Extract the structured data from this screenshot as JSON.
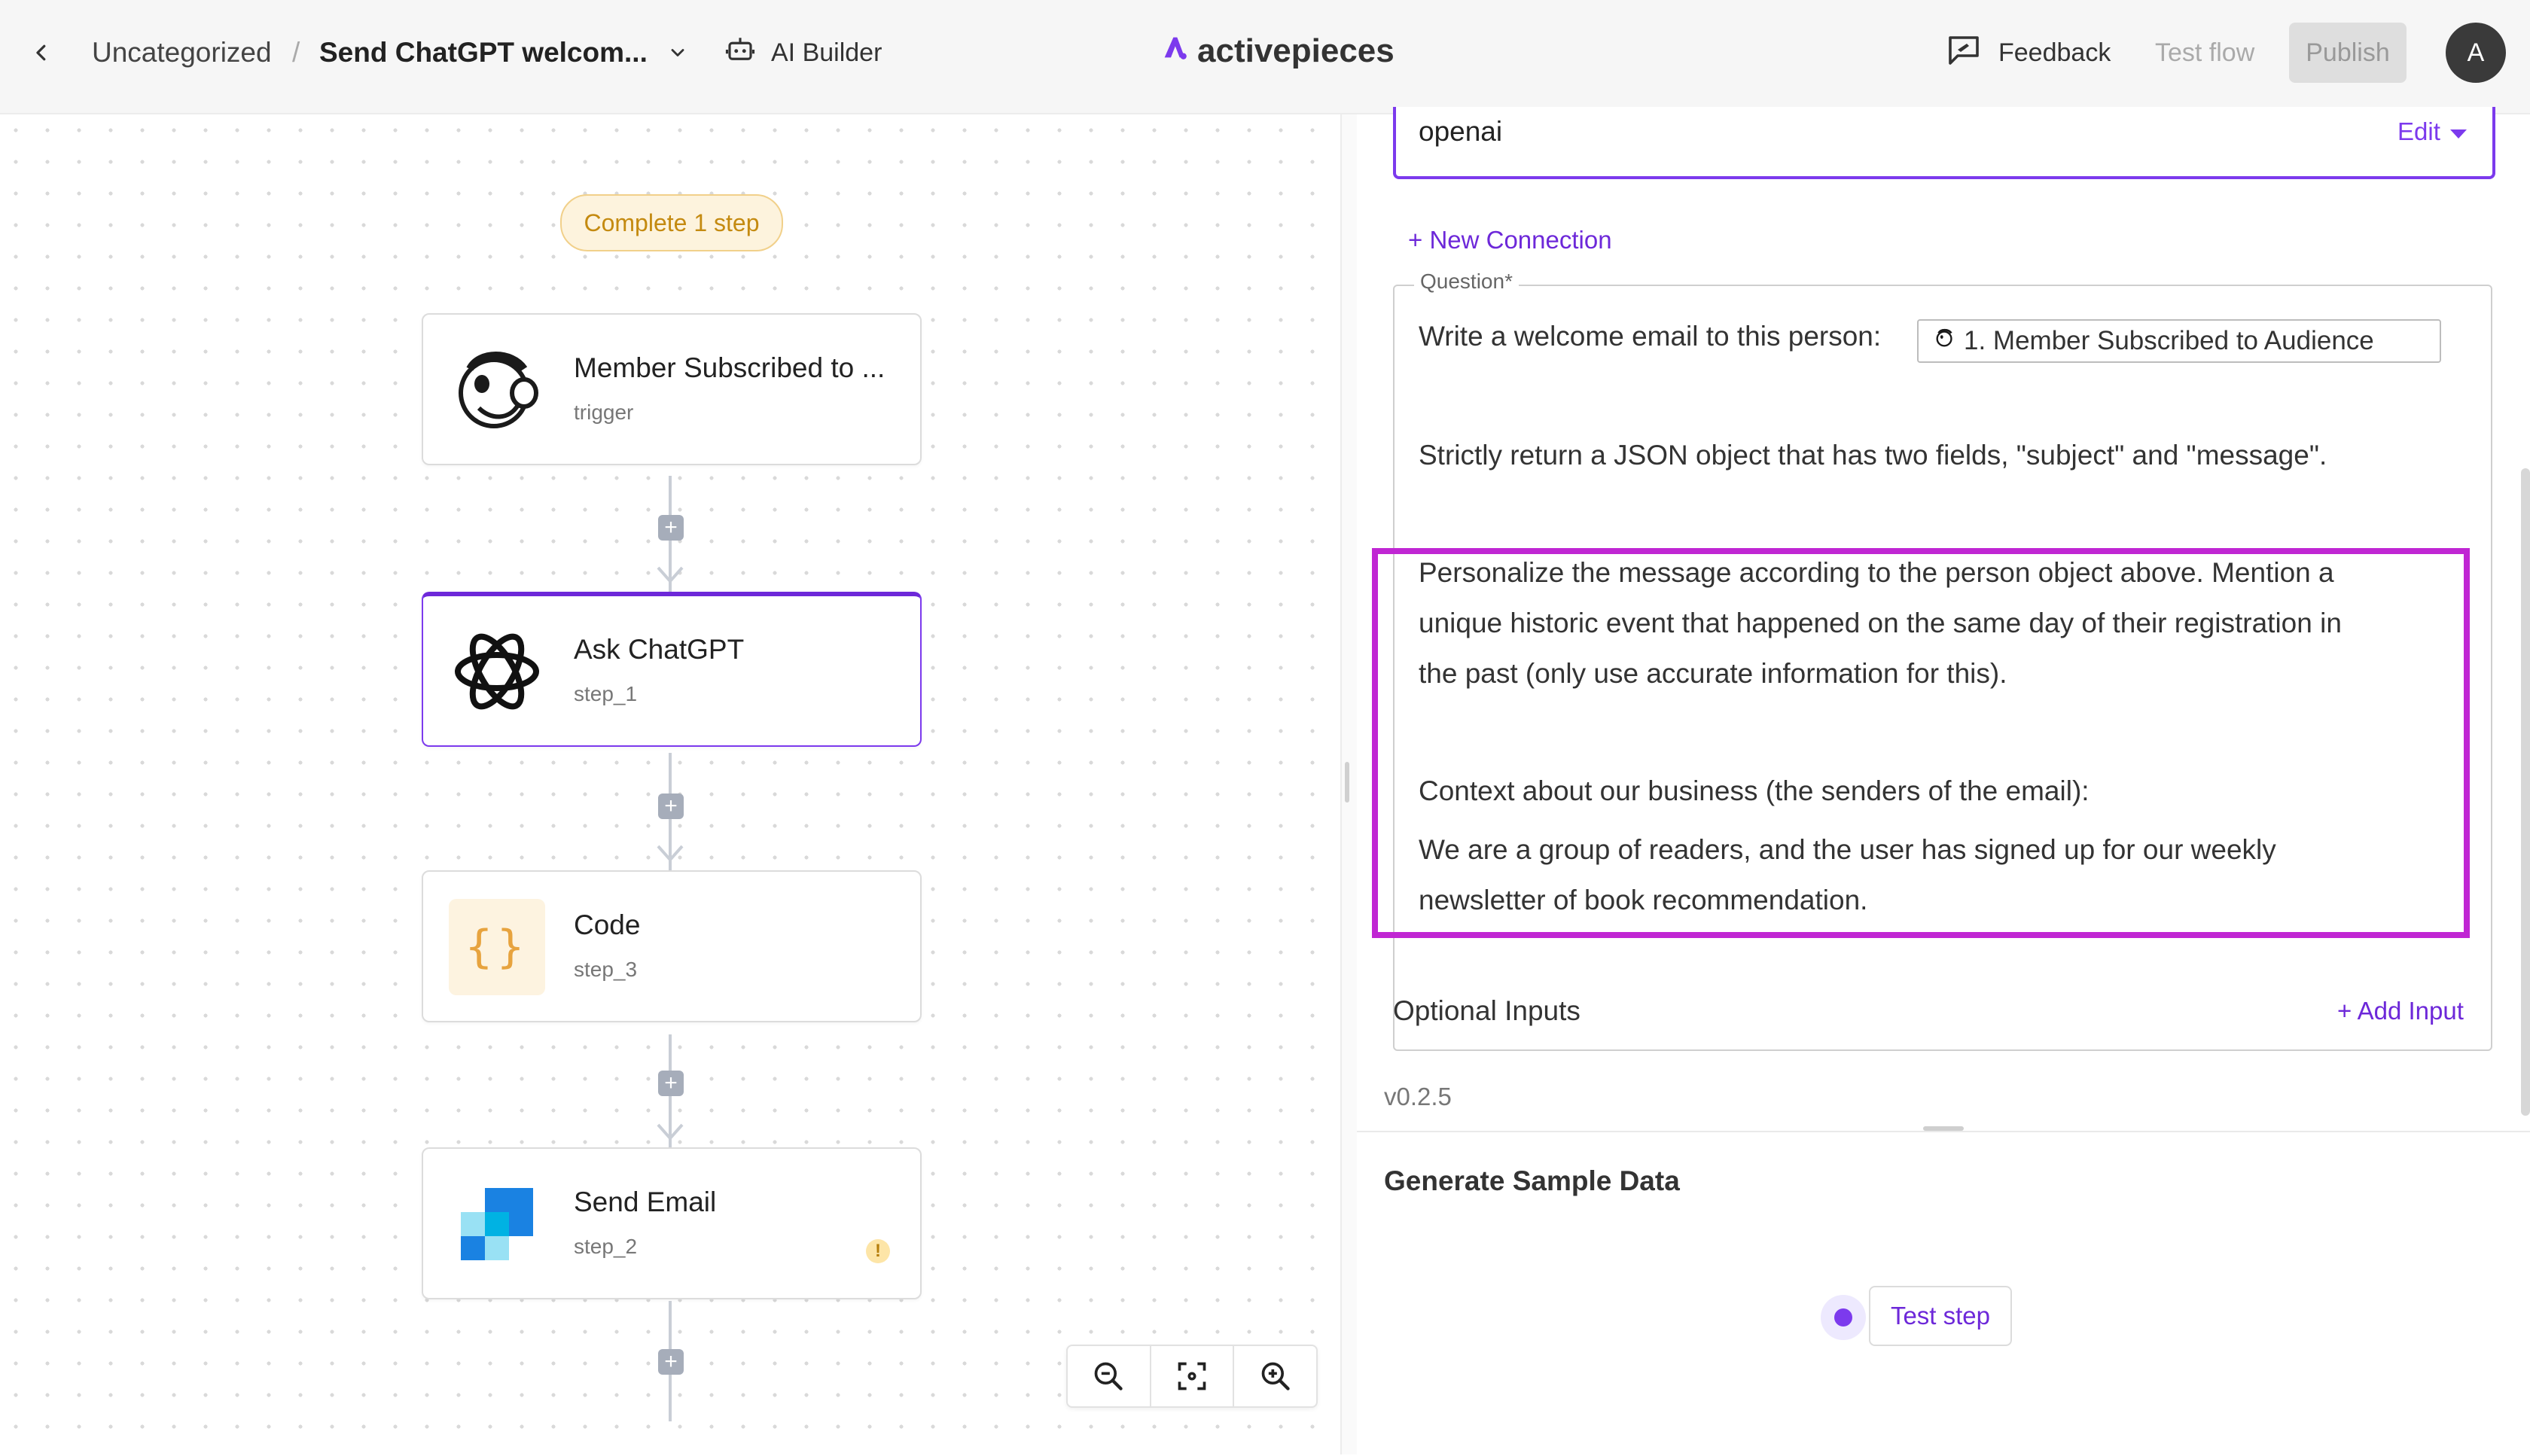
{
  "header": {
    "back_icon": "chevron-left-icon",
    "folder": "Uncategorized",
    "separator": "/",
    "flow_name": "Send ChatGPT welcom...",
    "flow_menu_icon": "chevron-down-icon",
    "ai_builder_label": "AI Builder",
    "ai_builder_icon": "robot-icon",
    "logo_text": "activepieces",
    "feedback_label": "Feedback",
    "feedback_icon": "feedback-icon",
    "test_flow_label": "Test flow",
    "publish_label": "Publish",
    "avatar_initial": "A"
  },
  "canvas": {
    "status_pill": "Complete 1 step",
    "steps": [
      {
        "title": "Member Subscribed to ...",
        "subtitle": "trigger",
        "icon": "mailchimp-icon"
      },
      {
        "title": "Ask ChatGPT",
        "subtitle": "step_1",
        "icon": "openai-icon",
        "selected": true
      },
      {
        "title": "Code",
        "subtitle": "step_3",
        "icon": "code-braces-icon"
      },
      {
        "title": "Send Email",
        "subtitle": "step_2",
        "icon": "sendgrid-icon",
        "warning": "!"
      }
    ],
    "zoom_controls": [
      "zoom-out-icon",
      "fit-view-icon",
      "zoom-in-icon"
    ]
  },
  "panel": {
    "connection_value": "openai",
    "connection_edit": "Edit",
    "new_connection": "+ New Connection",
    "question_label": "Question*",
    "question_line1_prefix": "Write a welcome email to this person:",
    "question_chip": "1. Member Subscribed to Audience",
    "question_line2": "Strictly return a JSON object that has two fields, \"subject\" and \"message\".",
    "question_line3a": "Personalize the message according to the person object above. Mention a",
    "question_line3b": "unique historic event that happened on the same day of their registration in",
    "question_line3c": "the past (only use accurate information for this).",
    "question_line4": "Context about our business (the senders of the email):",
    "question_line5a": "We are a group of readers, and the user has signed up for our weekly",
    "question_line5b": "newsletter of book recommendation.",
    "optional_inputs": "Optional Inputs",
    "add_input": "+ Add Input",
    "version": "v0.2.5",
    "sample_title": "Generate Sample Data",
    "test_step_label": "Test step"
  },
  "colors": {
    "accent": "#7c3aed",
    "highlight": "#c026d3",
    "pill_bg": "#fdf3dd",
    "pill_text": "#c48a10"
  }
}
